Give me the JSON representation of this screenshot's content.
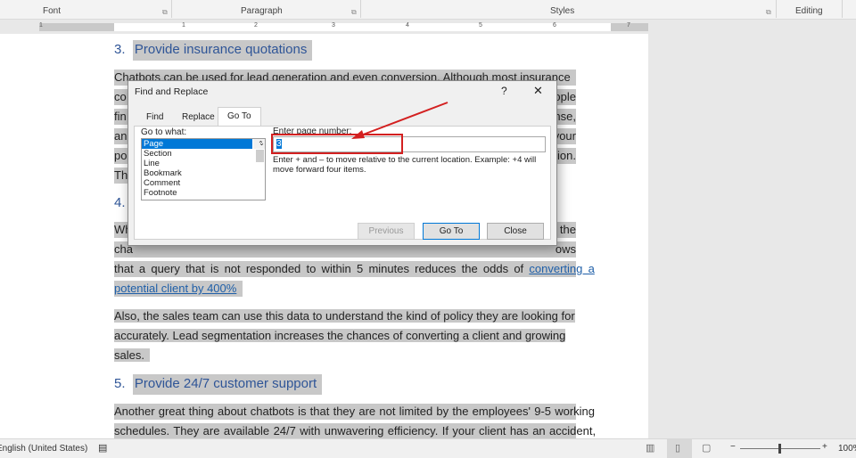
{
  "ribbon": {
    "groups": [
      "Font",
      "Paragraph",
      "Styles",
      "Editing"
    ]
  },
  "ruler": {
    "numbers": [
      "1",
      "1",
      "2",
      "3",
      "4",
      "5",
      "6",
      "7"
    ]
  },
  "document": {
    "heading3": {
      "num": "3.",
      "text": "Provide insurance quotations"
    },
    "para1": [
      "Chatbots can be used for lead generation and even conversion. Although most insurance",
      "co",
      "ople",
      "fin",
      "nse,",
      "an",
      "your",
      "po",
      "tion.",
      "Th"
    ],
    "heading4": {
      "num": "4."
    },
    "para2": [
      "Wh",
      "the",
      "cha",
      "ows"
    ],
    "para2_line3": "that a query that is not responded to within 5 minutes reduces the odds of",
    "para2_link1": "converting a",
    "para2_link2": "potential client by 400%",
    "para3": [
      "Also, the sales team can use this data to understand the kind of policy they are looking for",
      "accurately. Lead segmentation increases the chances of converting a client and growing",
      "sales."
    ],
    "heading5": {
      "num": "5.",
      "text": "Provide 24/7 customer support"
    },
    "para4": [
      "Another great thing about chatbots is that they are not limited by the employees' 9-5 working",
      "schedules. They are available 24/7 with unwavering efficiency. If your client has an accident,"
    ]
  },
  "dialog": {
    "title": "Find and Replace",
    "help": "?",
    "close_glyph": "✕",
    "tabs": [
      "Find",
      "Replace",
      "Go To"
    ],
    "active_tab": "Go To",
    "goto_label": "Go to what:",
    "goto_items": [
      "Page",
      "Section",
      "Line",
      "Bookmark",
      "Comment",
      "Footnote"
    ],
    "selected": "Page",
    "page_label": "Enter page number:",
    "page_value": "3",
    "hint": "Enter + and – to move relative to the current location. Example: +4 will move forward four items.",
    "buttons": {
      "previous": "Previous",
      "goto": "Go To",
      "close": "Close"
    },
    "annotation_color": "#d32020"
  },
  "status": {
    "language": "English (United States)",
    "zoom": "100%"
  }
}
